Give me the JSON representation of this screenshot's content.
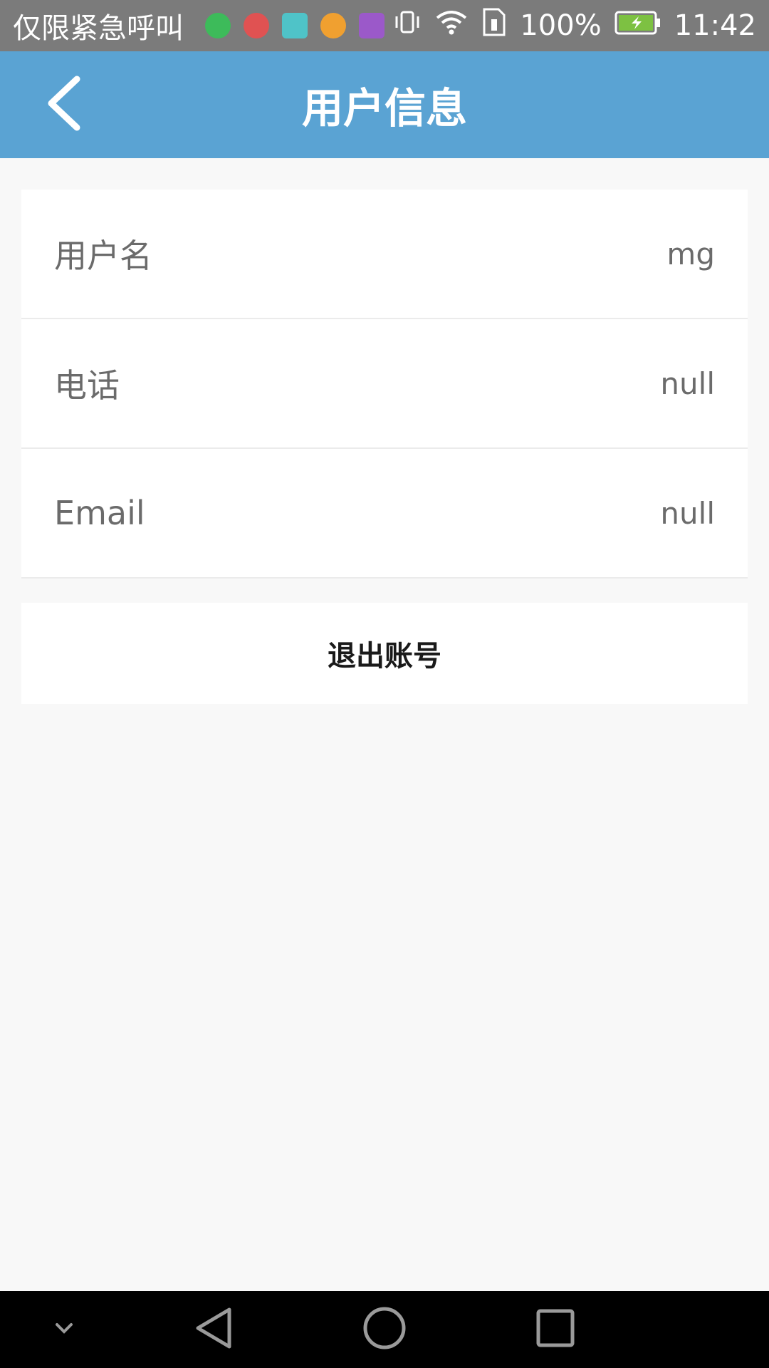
{
  "status_bar": {
    "carrier_text": "仅限紧急呼叫",
    "notification_icons": [
      {
        "name": "green-app-icon",
        "color": "#3dbb5a"
      },
      {
        "name": "red-app-icon",
        "color": "#e05252"
      },
      {
        "name": "android-icon",
        "color": "#4fc3c8"
      },
      {
        "name": "orange-app-icon",
        "color": "#f0a030"
      },
      {
        "name": "gallery-icon",
        "color": "#9b59c9"
      }
    ],
    "battery_percent": "100%",
    "time": "11:42"
  },
  "header": {
    "title": "用户信息"
  },
  "user_info": [
    {
      "label": "用户名",
      "value": "mg"
    },
    {
      "label": "电话",
      "value": "null"
    },
    {
      "label": "Email",
      "value": "null"
    }
  ],
  "logout_label": "退出账号",
  "colors": {
    "header_bg": "#5aa3d3",
    "status_bg": "#7b7b7b",
    "page_bg": "#f8f8f8"
  }
}
